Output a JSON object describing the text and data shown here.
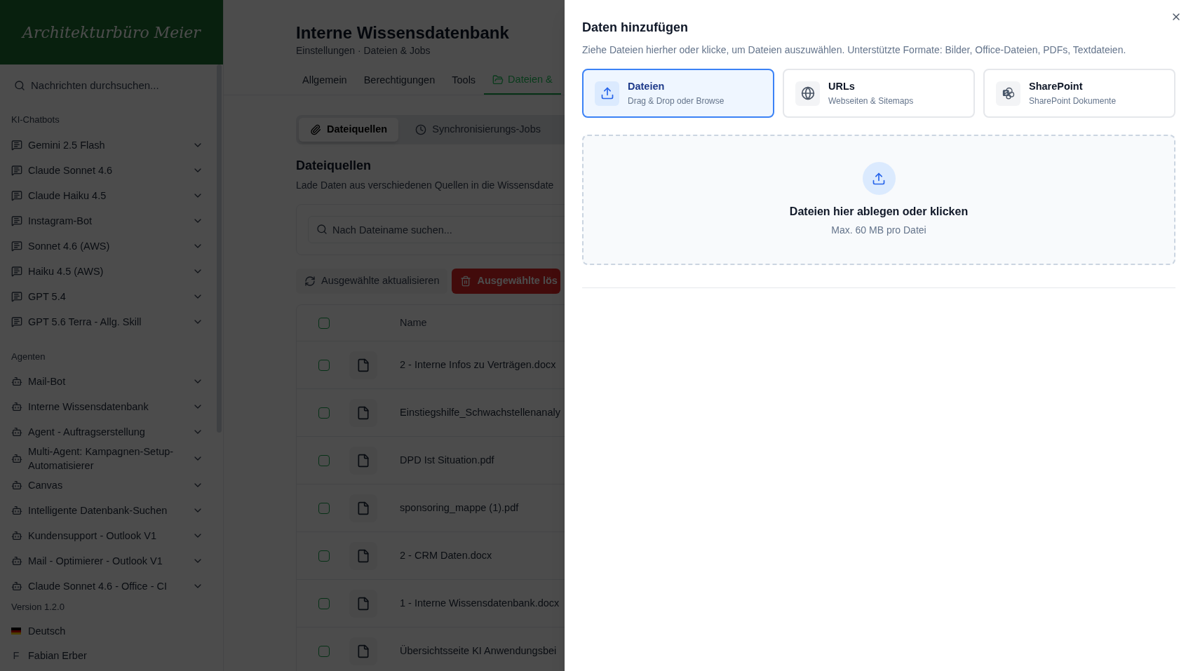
{
  "logo": {
    "text": "Architekturbüro Meier"
  },
  "sidebar": {
    "search": {
      "placeholder": "Nachrichten durchsuchen..."
    },
    "sections": [
      {
        "title": "KI-Chatbots",
        "kind": "chatbot",
        "items": [
          "Gemini 2.5 Flash",
          "Claude Sonnet 4.6",
          "Claude Haiku 4.5",
          "Instagram-Bot",
          "Sonnet 4.6 (AWS)",
          "Haiku 4.5 (AWS)",
          "GPT 5.4",
          "GPT 5.6 Terra - Allg. Skill"
        ]
      },
      {
        "title": "Agenten",
        "kind": "agent",
        "items": [
          "Mail-Bot",
          "Interne Wissensdatenbank",
          "Agent - Auftragserstellung",
          "Multi-Agent: Kampagnen-Setup-Automatisierer",
          "Canvas",
          "Intelligente Datenbank-Suchen",
          "Kundensupport - Outlook V1",
          "Mail - Optimierer - Outlook V1",
          "Claude Sonnet 4.6 - Office - CI"
        ]
      }
    ],
    "version": "Version 1.2.0",
    "language": "Deutsch",
    "user": {
      "initial": "F",
      "name": "Fabian Erber"
    }
  },
  "page": {
    "title": "Interne Wissensdatenbank",
    "breadcrumb": "Einstellungen · Dateien & Jobs",
    "tabs": [
      {
        "label": "Allgemein",
        "selected": false
      },
      {
        "label": "Berechtigungen",
        "selected": false
      },
      {
        "label": "Tools",
        "selected": false
      },
      {
        "label": "Dateien &",
        "selected": true
      }
    ],
    "subtabs": [
      {
        "label": "Dateiquellen",
        "kind": "sources",
        "selected": true
      },
      {
        "label": "Synchronisierungs-Jobs",
        "kind": "jobs",
        "selected": false
      }
    ],
    "section": {
      "title": "Dateiquellen",
      "description": "Lade Daten aus verschiedenen Quellen in die Wissensdate"
    },
    "search": {
      "placeholder": "Nach Dateiname suchen..."
    },
    "actions": [
      {
        "label": "Ausgewählte aktualisieren",
        "kind": "refresh"
      },
      {
        "label": "Ausgewählte lös",
        "kind": "delete"
      }
    ],
    "table": {
      "select_all": {
        "checked": false
      },
      "columns": [
        "Name"
      ],
      "rows": [
        {
          "name": "2 - Interne Infos zu Verträgen.docx",
          "checked": false
        },
        {
          "name": "Einstiegshilfe_Schwachstellenanaly",
          "checked": false
        },
        {
          "name": "DPD Ist Situation.pdf",
          "checked": false
        },
        {
          "name": "sponsoring_mappe (1).pdf",
          "checked": false
        },
        {
          "name": "2 - CRM Daten.docx",
          "checked": false
        },
        {
          "name": "1 - Interne Wissensdatenbank.docx",
          "checked": false
        },
        {
          "name": "Übersichtsseite KI Anwendungsbei",
          "checked": false
        }
      ]
    }
  },
  "dialog": {
    "title": "Daten hinzufügen",
    "description": "Ziehe Dateien hierher oder klicke, um Dateien auszuwählen. Unterstützte Formate: Bilder, Office-Dateien, PDFs, Textdateien.",
    "sources": [
      {
        "title": "Dateien",
        "subtitle": "Drag & Drop oder Browse",
        "kind": "files",
        "selected": true
      },
      {
        "title": "URLs",
        "subtitle": "Webseiten & Sitemaps",
        "kind": "urls",
        "selected": false
      },
      {
        "title": "SharePoint",
        "subtitle": "SharePoint Dokumente",
        "kind": "sharepoint",
        "selected": false
      }
    ],
    "dropzone": {
      "title": "Dateien hier ablegen oder klicken",
      "hint": "Max. 60 MB pro Datei"
    }
  }
}
